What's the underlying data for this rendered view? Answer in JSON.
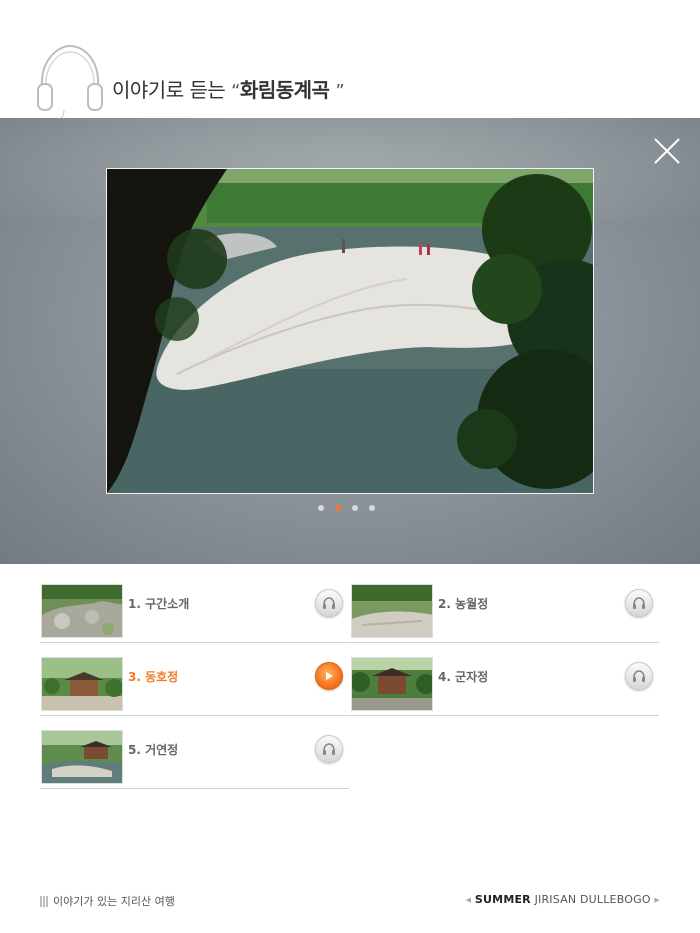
{
  "header": {
    "title_prefix": "이야기로 듣는",
    "open_quote": "“",
    "title_name": "화림동계곡",
    "close_quote": "”"
  },
  "viewer": {
    "slides_count": 4,
    "active_slide": 2
  },
  "tracks": [
    {
      "label": "1. 구간소개",
      "active": false,
      "thumb": "rocky-stream"
    },
    {
      "label": "2. 농월정",
      "active": false,
      "thumb": "rock-garden"
    },
    {
      "label": "3. 동호정",
      "active": true,
      "thumb": "pavilion-forest"
    },
    {
      "label": "4. 군자정",
      "active": false,
      "thumb": "pavilion-trees"
    },
    {
      "label": "5. 거연정",
      "active": false,
      "thumb": "pavilion-river"
    }
  ],
  "footer": {
    "left_text": "이야기가 있는 지리산 여행",
    "brand_bold": "SUMMER",
    "brand_rest": "JIRISAN DULLEBOGO"
  },
  "colors": {
    "accent": "#f07a28",
    "overlay": "#8e959c"
  }
}
